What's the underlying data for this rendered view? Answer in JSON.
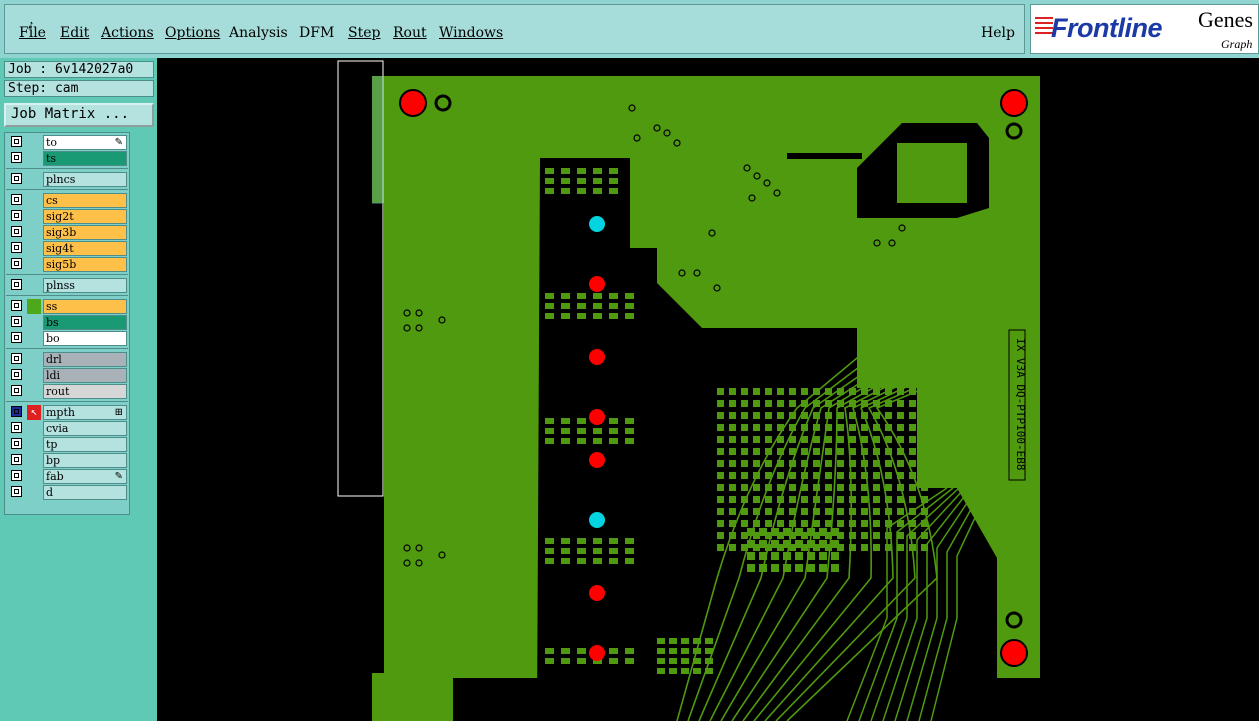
{
  "menu": {
    "items": [
      "File",
      "Edit",
      "Actions",
      "Options",
      "Analysis",
      "DFM",
      "Step",
      "Rout",
      "Windows"
    ],
    "help": "Help"
  },
  "logo": {
    "brand": "Frontline",
    "product": "Genes",
    "subtitle": "Graph"
  },
  "job": {
    "job_label": "Job : 6v142027a0",
    "step_label": "Step: cam",
    "matrix_button": "Job Matrix ..."
  },
  "layers": [
    {
      "name": "to",
      "color": "#ffffff",
      "affected": false,
      "mark": "pencil"
    },
    {
      "name": "ts",
      "color": "#199a74",
      "affected": false
    },
    {
      "name": "plncs",
      "color": "#b4e2df",
      "affected": false
    },
    {
      "name": "cs",
      "color": "#ffc04a",
      "affected": false
    },
    {
      "name": "sig2t",
      "color": "#ffc04a",
      "affected": false
    },
    {
      "name": "sig3b",
      "color": "#ffc04a",
      "affected": false
    },
    {
      "name": "sig4t",
      "color": "#ffc04a",
      "affected": false
    },
    {
      "name": "sig5b",
      "color": "#ffc04a",
      "affected": false
    },
    {
      "name": "plnss",
      "color": "#b4e2df",
      "affected": false
    },
    {
      "name": "ss",
      "color": "#ffc04a",
      "affected": false,
      "swatch": "#4da81c"
    },
    {
      "name": "bs",
      "color": "#199a74",
      "affected": false
    },
    {
      "name": "bo",
      "color": "#ffffff",
      "affected": false
    },
    {
      "name": "drl",
      "color": "#a9b2b8",
      "affected": false
    },
    {
      "name": "ldi",
      "color": "#a9b2b8",
      "affected": false
    },
    {
      "name": "rout",
      "color": "#d6d6d6",
      "affected": false
    },
    {
      "name": "mpth",
      "color": "#b4e2df",
      "affected": true,
      "mark": "grid"
    },
    {
      "name": "cvia",
      "color": "#b4e2df",
      "affected": false
    },
    {
      "name": "tp",
      "color": "#b4e2df",
      "affected": false
    },
    {
      "name": "bp",
      "color": "#b4e2df",
      "affected": false
    },
    {
      "name": "fab",
      "color": "#b4e2df",
      "affected": false,
      "mark": "pencil"
    },
    {
      "name": "d",
      "color": "#b4e2df",
      "affected": false
    }
  ],
  "board": {
    "copper_color": "#4f9a0e",
    "trace_color": "#000000",
    "silk_text": "IX V3A DQ-PTP100-EB8",
    "fiducial_color": "#ff0000",
    "highlight_color": "#00d4e0"
  }
}
